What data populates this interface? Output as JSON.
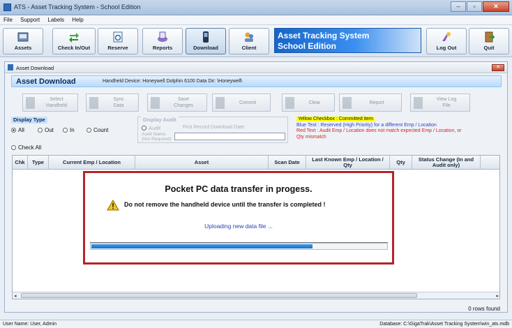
{
  "window": {
    "title": "ATS - Asset Tracking System - School Edition",
    "minimize": "–",
    "maximize": "▫",
    "close": "✕"
  },
  "menu": [
    "File",
    "Support",
    "Labels",
    "Help"
  ],
  "toolbar": {
    "buttons": [
      {
        "label": "Assets",
        "icon": "assets-icon"
      },
      {
        "label": "Check In/Out",
        "icon": "check-in-out-icon"
      },
      {
        "label": "Reserve",
        "icon": "reserve-icon"
      },
      {
        "label": "Reports",
        "icon": "reports-icon"
      },
      {
        "label": "Download",
        "icon": "download-icon"
      },
      {
        "label": "Client",
        "icon": "client-icon"
      }
    ],
    "brand_line1": "Asset Tracking System",
    "brand_line2": "School Edition",
    "logout_label": "Log Out",
    "quit_label": "Quit"
  },
  "child_window": {
    "title": "Asset Download",
    "close": "✕"
  },
  "header": {
    "title": "Asset Download",
    "device_text": "Handheld Device: Honeywell Dolphin 6100    Data Dir: \\Honeywell\\"
  },
  "actions": {
    "select": [
      "Select",
      "Handheld"
    ],
    "sync": [
      "Sync",
      "Data"
    ],
    "save": [
      "Save",
      "Changes"
    ],
    "commit": "Commit",
    "clear": "Clear",
    "report": "Report",
    "view_log": [
      "View Log",
      "File"
    ]
  },
  "display_type": {
    "title": "Display Type",
    "options": [
      "All",
      "Out",
      "In",
      "Count"
    ],
    "selected": "All",
    "check_all": "Check All"
  },
  "display_audit": {
    "title": "Display Audit",
    "audit": "Audit",
    "first_record": "First Record Download Date:",
    "audit_name": "Audit Name:",
    "not_required": "(Not Required)"
  },
  "legend": {
    "yellow": "Yellow Checkbox : Committed item",
    "blue": "Blue Text : Reserved (High Priority) for a different Emp / Location",
    "red": "Red Text : Audit Emp / Location does not match expected Emp / Location, or Qty mismatch"
  },
  "table": {
    "columns": [
      "Chk",
      "Type",
      "Current Emp / Location",
      "Asset",
      "Scan Date",
      "Last Known Emp / Location / Qty",
      "Qty",
      "Status Change (In and Audit only)"
    ],
    "rows_found": "0 rows found"
  },
  "dialog": {
    "title": "Pocket PC data transfer in progess.",
    "warning": "Do not remove the handheld device until the transfer is completed !",
    "status": "Uploading new data file ...",
    "progress": 0.75
  },
  "statusbar": {
    "left": "User Name: User, Admin",
    "right": "Database: C:\\GigaTrak\\Asset Tracking System\\win_ats.mdb"
  }
}
